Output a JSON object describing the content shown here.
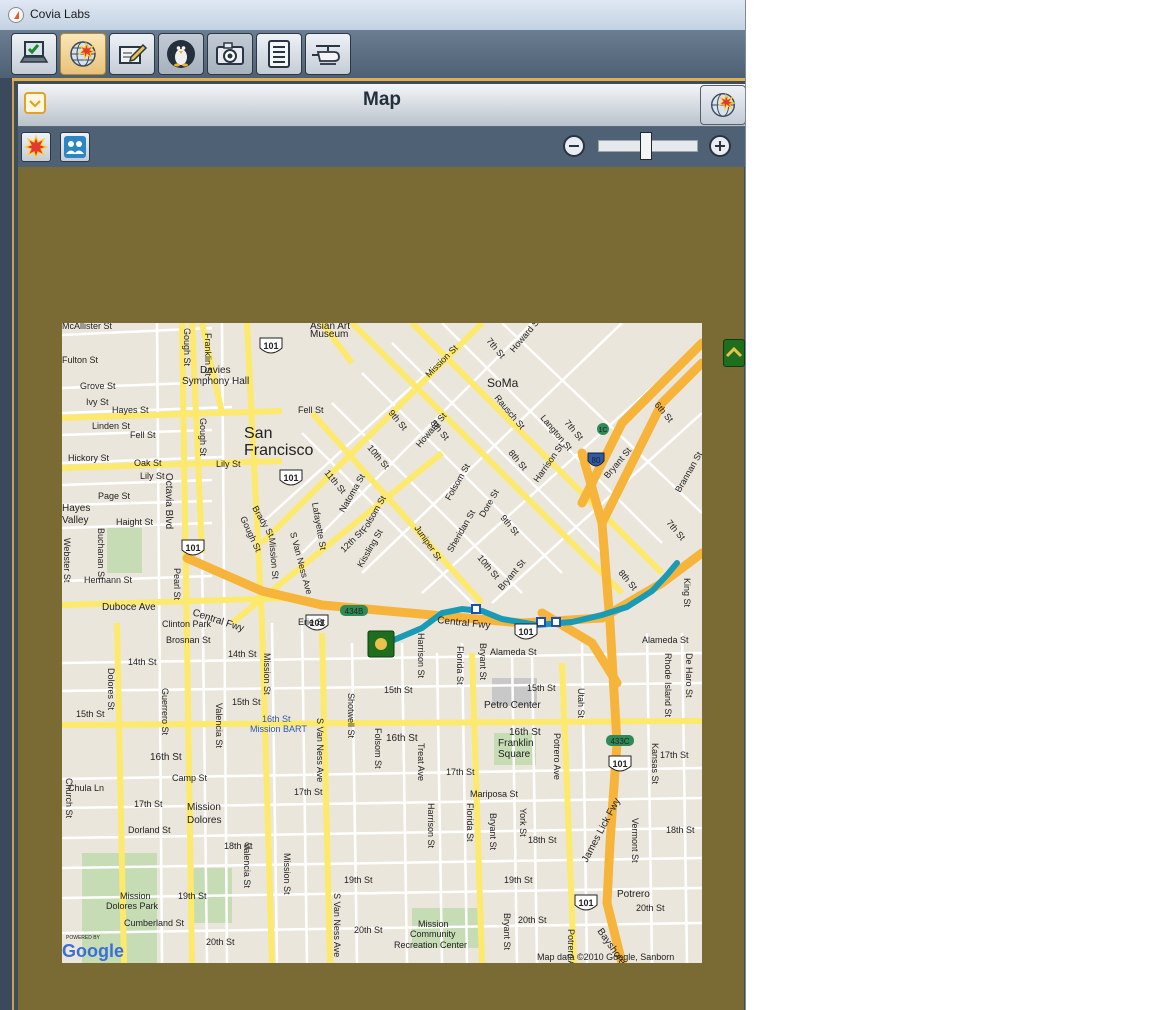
{
  "window": {
    "title": "Covia Labs"
  },
  "toolbar": {
    "buttons": [
      {
        "icon": "laptop-check-icon",
        "state": "normal"
      },
      {
        "icon": "globe-burst-icon",
        "state": "active"
      },
      {
        "icon": "notepad-pencil-icon",
        "state": "normal"
      },
      {
        "icon": "penguin-icon",
        "state": "pressed"
      },
      {
        "icon": "camera-icon",
        "state": "pressed"
      },
      {
        "icon": "list-icon",
        "state": "normal"
      },
      {
        "icon": "helicopter-icon",
        "state": "normal"
      }
    ]
  },
  "panel": {
    "title": "Map",
    "check_icon": "check-icon",
    "corner_icon": "globe-burst-icon"
  },
  "map_toolbar": {
    "left_buttons": [
      "starburst-icon",
      "group-icon"
    ],
    "zoom_out_icon": "minus-icon",
    "zoom_in_icon": "plus-icon",
    "zoom_level_fraction": 0.5
  },
  "map": {
    "city_label": [
      "San",
      "Francisco"
    ],
    "soma_label": "SoMa",
    "streets": {
      "mcallister": "McAllister St",
      "fulton": "Fulton St",
      "grove": "Grove St",
      "ivy": "Ivy St",
      "hayes": "Hayes St",
      "linden": "Linden St",
      "fell": "Fell St",
      "hickory": "Hickory St",
      "oak": "Oak St",
      "lily": "Lily St",
      "page": "Page St",
      "haight": "Haight St",
      "hermann": "Hermann St",
      "duboce": "Duboce Ave",
      "clinton": "Clinton Park",
      "brosnan": "Brosnan St",
      "fourteenth": "14th St",
      "fifteenth": "15th St",
      "sixteenth": "16th St",
      "seventeenth": "17th St",
      "eighteenth": "18th St",
      "nineteenth": "19th St",
      "twentieth": "20th St",
      "chula": "Chula Ln",
      "camp": "Camp St",
      "dorland": "Dorland St",
      "cumberland": "Cumberland St",
      "octavia": "Octavia Blvd",
      "gough": "Gough St",
      "franklin": "Franklin St",
      "mission": "Mission St",
      "svanness": "S Van Ness Ave",
      "dolores": "Dolores St",
      "guerrero": "Guerrero St",
      "valencia": "Valencia St",
      "folsom": "Folsom St",
      "harrison": "Harrison St",
      "bryant": "Bryant St",
      "florida": "Florida St",
      "potrero": "Potrero Ave",
      "alameda": "Alameda St",
      "erie": "Erie St",
      "eighth": "8th St",
      "ninth": "9th St",
      "tenth": "10th St",
      "eleventh": "11th St",
      "twelfth": "12th St",
      "seventh": "7th St",
      "sixth": "6th St",
      "howard": "Howard St",
      "natoma": "Natoma St",
      "rausch": "Rausch St",
      "langton": "Langton St",
      "central_fwy": "Central Fwy",
      "james_lick": "James Lick Fwy",
      "bayshore": "Bayshore",
      "kansas": "Kansas St",
      "rhode": "Rhode Island St",
      "deharo": "De Haro St",
      "vermont": "Vermont St",
      "utah": "Utah St",
      "york": "York St",
      "treat": "Treat Ave",
      "shotwell": "Shotwell St",
      "mariposa": "Mariposa St",
      "brady": "Brady St",
      "lafayette": "Lafayette St",
      "kissling": "Kissling St",
      "juniper": "Juniper St",
      "sheridan": "Sheridan St",
      "dore": "Dore St",
      "webster": "Webster St",
      "buchanan": "Buchanan St",
      "pearl": "Pearl St",
      "church": "Church St",
      "king": "King St",
      "brannan": "Brannan St"
    },
    "pois": {
      "davies": [
        "Davies",
        "Symphony Hall"
      ],
      "museum": [
        "Asian Art",
        "Museum"
      ],
      "petro": "Petro Center",
      "franklin_sq": [
        "Franklin",
        "Square"
      ],
      "mission_dolores": [
        "Mission",
        "Dolores"
      ],
      "mission_park": [
        "Mission",
        "Dolores Park"
      ],
      "rec_center": [
        "Mission",
        "Community",
        "Recreation Center"
      ],
      "bart": [
        "16th St",
        "Mission BART"
      ],
      "potrero_hill": "Potrero",
      "hayes_valley": [
        "Hayes",
        "Valley"
      ]
    },
    "shields": {
      "us101": "101",
      "i80": "80",
      "exit434b": "434B",
      "exit433c": "433C",
      "exit1c": "1C"
    },
    "route_color": "#1a9bb5",
    "highway_color": "#f7b43b",
    "arterial_color": "#fde96b",
    "attribution": "Map data ©2010 Google, Sanborn",
    "logo": {
      "powered_by": "POWERED BY",
      "name": "Google"
    }
  },
  "colors": {
    "titlebar": "#c3d2e3",
    "toolbar": "#5a6c80",
    "panel_frame_accent": "#e0b04f",
    "map_background": "#7a6a34",
    "map_land": "#ebe6dc"
  }
}
